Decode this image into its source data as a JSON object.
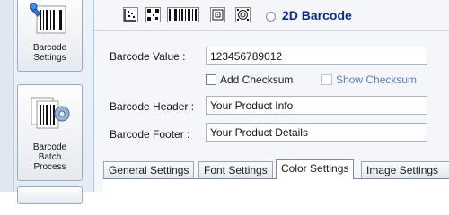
{
  "sidebar": {
    "items": [
      {
        "label_line1": "Barcode",
        "label_line2": "Settings",
        "icon": "barcode-wrench-icon"
      },
      {
        "label_line1": "Barcode",
        "label_line2": "Batch",
        "label_line3": "Process",
        "icon": "barcode-batch-gear-icon"
      }
    ]
  },
  "barcode_types": {
    "icons": [
      "datamatrix-icon",
      "qr-code-icon",
      "pdf417-icon",
      "aztec-icon",
      "maxicode-icon"
    ],
    "option_2d_label": "2D Barcode"
  },
  "form": {
    "value_label": "Barcode Value :",
    "value": "123456789012",
    "add_checksum_label": "Add Checksum",
    "show_checksum_label": "Show Checksum",
    "header_label": "Barcode Header :",
    "header_value": "Your Product Info",
    "footer_label": "Barcode Footer :",
    "footer_value": "Your Product Details"
  },
  "tabs": [
    {
      "label": "General Settings"
    },
    {
      "label": "Font Settings"
    },
    {
      "label": "Color Settings",
      "active": true
    },
    {
      "label": "Image Settings"
    }
  ],
  "colors": {
    "accent": "#0a2b8c",
    "disabled_text": "#5b7fb0"
  }
}
